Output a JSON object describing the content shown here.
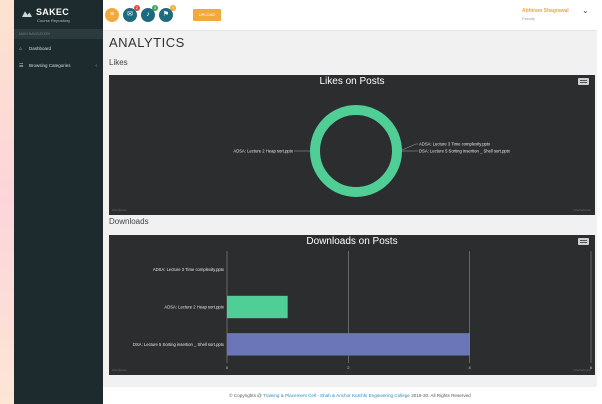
{
  "brand": {
    "name": "SAKEC",
    "subtitle": "Course Repository"
  },
  "sidebar": {
    "nav_heading": "MAIN NAVIGATION",
    "items": [
      {
        "label": "Dashboard",
        "icon": "home-icon"
      },
      {
        "label": "Browsing Categories",
        "icon": "list-icon",
        "has_submenu": true
      }
    ]
  },
  "topbar": {
    "badges": [
      "2",
      "3",
      "9"
    ],
    "upload_label": "UPLOAD",
    "user_name": "Abhiram Shagrawal",
    "user_role": "Faculty"
  },
  "page": {
    "title": "ANALYTICS",
    "likes_label": "Likes",
    "downloads_label": "Downloads"
  },
  "charts_meta": {
    "credits": "Zoho Service",
    "watermark": "zohocharts.com"
  },
  "chart_data": [
    {
      "type": "pie",
      "style": "donut",
      "title": "Likes on Posts",
      "slices": [
        {
          "label": "ADSA: Lecture 2 Heap sort.pptx",
          "value": 1,
          "color": "#4fcf96"
        },
        {
          "label": "ADSA: Lecture 3 Time complexity.pptx",
          "value": 0,
          "color": "#6b76b8"
        },
        {
          "label": "DSA: Lecture 5 Sorting insertion _ Shell sort.pptx",
          "value": 0,
          "color": "#e2df6c"
        }
      ]
    },
    {
      "type": "bar",
      "orientation": "horizontal",
      "title": "Downloads on Posts",
      "categories": [
        "ADSA: Lecture 3 Time complexity.pptx",
        "ADSA: Lecture 2 Heap sort.pptx",
        "DSA: Lecture 5 Sorting insertion _ Shell sort.pptx"
      ],
      "values": [
        0,
        1,
        4
      ],
      "colors": [
        "#4fcf96",
        "#4fcf96",
        "#6b76b8"
      ],
      "xlim": [
        0,
        6
      ],
      "xticks": [
        "0",
        "2",
        "4",
        "6"
      ],
      "grid": true
    }
  ],
  "footer": {
    "prefix": "© Copyrights @ ",
    "link_text": "Training & Placement Cell - Shah & Anchor Kutchhi Engineering College",
    "suffix": " 2019-20. All Rights Reserved"
  }
}
